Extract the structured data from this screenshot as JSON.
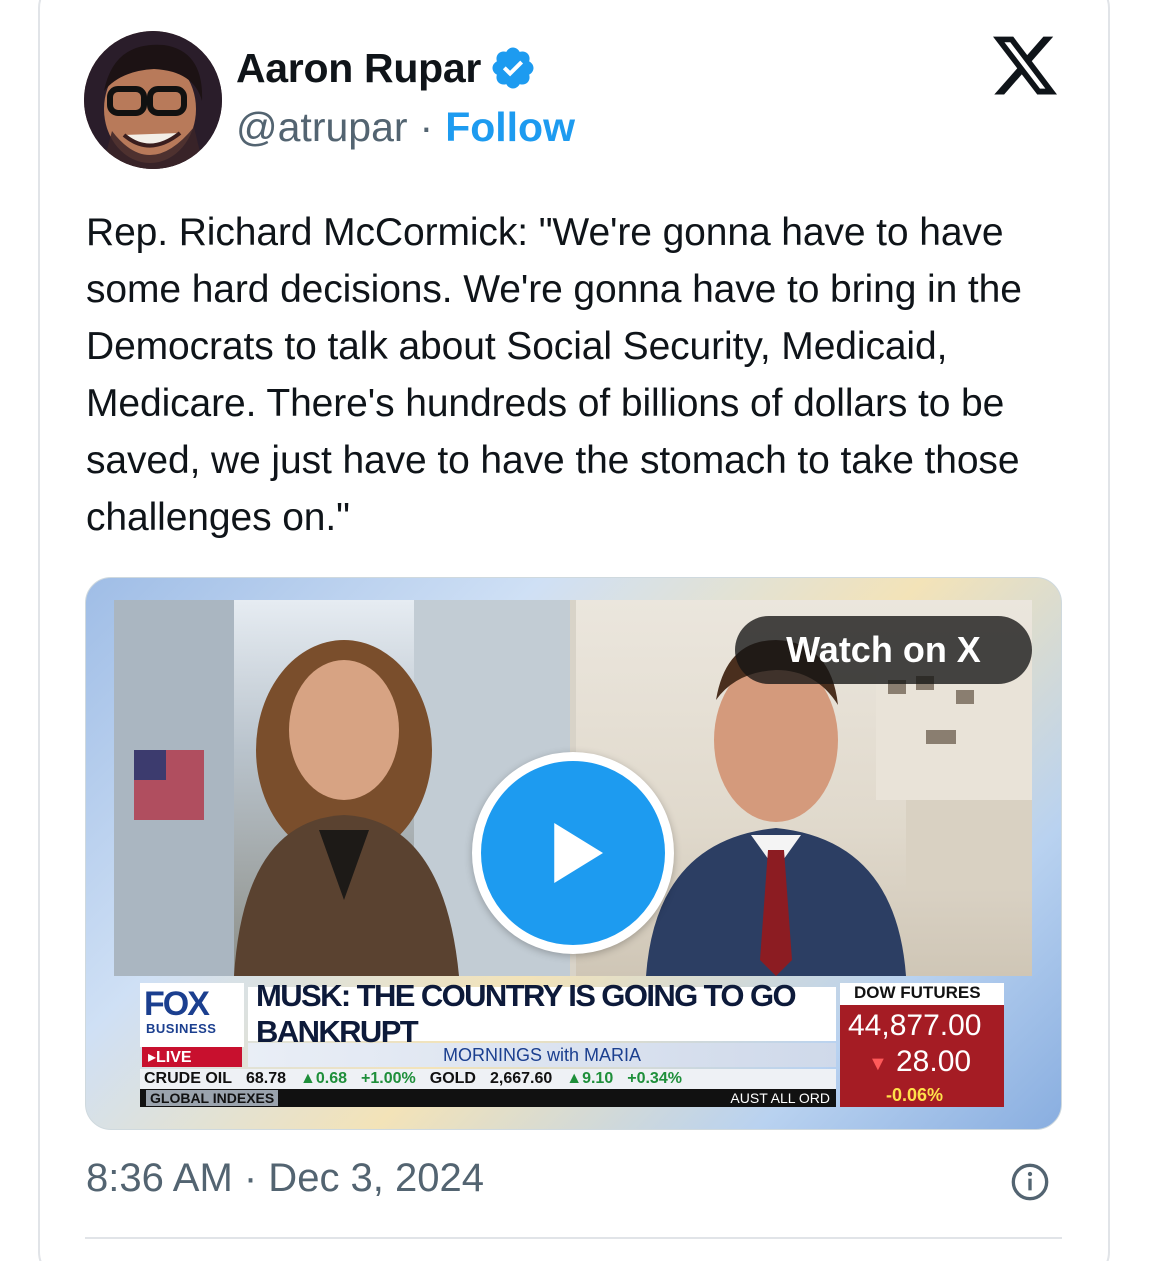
{
  "author": {
    "name": "Aaron Rupar",
    "handle": "@atrupar",
    "separator": "·",
    "follow_label": "Follow"
  },
  "tweet": {
    "text": "Rep. Richard McCormick: \"We're gonna have to have some hard decisions. We're gonna have to bring in the Democrats to talk about Social Security, Medicaid, Medicare. There's hundreds of billions of dollars to be saved, we just have to have the stomach to take those challenges on.\"",
    "timestamp": "8:36 AM · Dec 3, 2024"
  },
  "media": {
    "watch_label": "Watch on X",
    "broadcast": {
      "network": "FOX",
      "network_sub": "BUSINESS",
      "live": "LIVE",
      "headline": "MUSK: THE COUNTRY IS GOING TO GO BANKRUPT",
      "show": "MORNINGS with MARIA",
      "ticker": {
        "crude_label": "CRUDE OIL",
        "crude_value": "68.78",
        "crude_change": "▲0.68",
        "crude_pct": "+1.00%",
        "gold_label": "GOLD",
        "gold_value": "2,667.60",
        "gold_change": "▲9.10",
        "gold_pct": "+0.34%",
        "global_label": "GLOBAL INDEXES",
        "index_label": "AUST ALL ORD"
      },
      "dow": {
        "title": "DOW FUTURES",
        "value": "44,877.00",
        "change": "28.00",
        "pct": "-0.06%"
      }
    }
  },
  "colors": {
    "accent": "#1d9bf0",
    "text_primary": "#0f1419",
    "text_secondary": "#536471"
  },
  "icons": [
    "verified-badge-icon",
    "x-logo-icon",
    "play-icon",
    "info-icon"
  ]
}
